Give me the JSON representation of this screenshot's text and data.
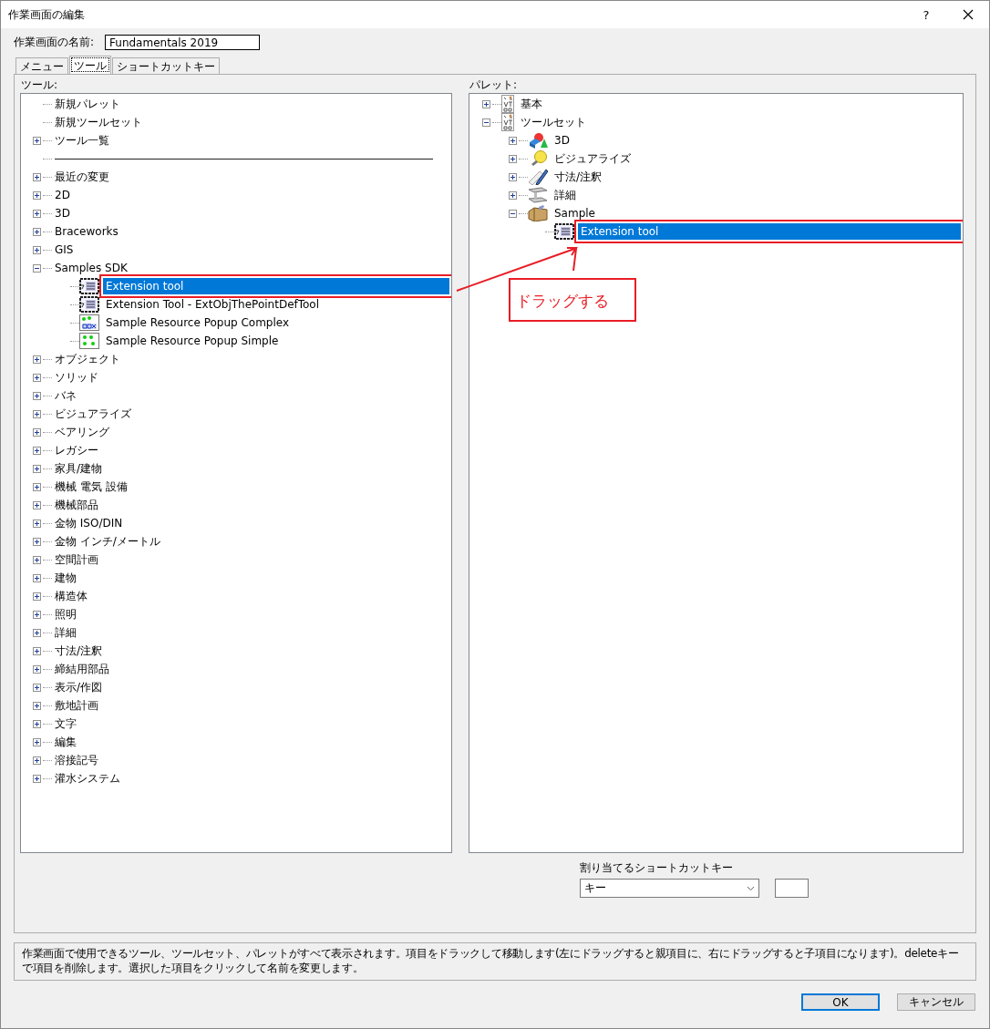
{
  "window": {
    "title": "作業画面の編集",
    "help_button": "?"
  },
  "name_field": {
    "label": "作業画面の名前:",
    "value": "Fundamentals 2019"
  },
  "tabs": [
    {
      "label": "メニュー",
      "selected": false
    },
    {
      "label": "ツール",
      "selected": true
    },
    {
      "label": "ショートカットキー",
      "selected": false
    }
  ],
  "tools_panel": {
    "label": "ツール:",
    "items": [
      {
        "label": "新規パレット",
        "kind": "entry",
        "selected": false
      },
      {
        "label": "新規ツールセット",
        "kind": "entry",
        "selected": false
      },
      {
        "label": "ツール一覧",
        "kind": "folder",
        "expanded": false,
        "selected": false
      },
      {
        "kind": "separator"
      },
      {
        "label": "最近の変更",
        "kind": "folder",
        "expanded": false,
        "selected": false
      },
      {
        "label": "2D",
        "kind": "folder",
        "expanded": false,
        "selected": false
      },
      {
        "label": "3D",
        "kind": "folder",
        "expanded": false,
        "selected": false
      },
      {
        "label": "Braceworks",
        "kind": "folder",
        "expanded": false,
        "selected": false
      },
      {
        "label": "GIS",
        "kind": "folder",
        "expanded": false,
        "selected": false
      },
      {
        "label": "Samples SDK",
        "kind": "folder",
        "expanded": true,
        "selected": false,
        "children": [
          {
            "label": "Extension tool",
            "kind": "tool",
            "selected": true,
            "marked": true
          },
          {
            "label": "Extension Tool - ExtObjThePointDefTool",
            "kind": "tool",
            "selected": false
          },
          {
            "label": "Sample Resource Popup Complex",
            "kind": "popup-complex",
            "selected": false
          },
          {
            "label": "Sample Resource Popup Simple",
            "kind": "popup-simple",
            "selected": false
          }
        ]
      },
      {
        "label": "オブジェクト",
        "kind": "folder",
        "expanded": false,
        "selected": false
      },
      {
        "label": "ソリッド",
        "kind": "folder",
        "expanded": false,
        "selected": false
      },
      {
        "label": "バネ",
        "kind": "folder",
        "expanded": false,
        "selected": false
      },
      {
        "label": "ビジュアライズ",
        "kind": "folder",
        "expanded": false,
        "selected": false
      },
      {
        "label": "ベアリング",
        "kind": "folder",
        "expanded": false,
        "selected": false
      },
      {
        "label": "レガシー",
        "kind": "folder",
        "expanded": false,
        "selected": false
      },
      {
        "label": "家具/建物",
        "kind": "folder",
        "expanded": false,
        "selected": false
      },
      {
        "label": "機械 電気 設備",
        "kind": "folder",
        "expanded": false,
        "selected": false
      },
      {
        "label": "機械部品",
        "kind": "folder",
        "expanded": false,
        "selected": false
      },
      {
        "label": "金物 ISO/DIN",
        "kind": "folder",
        "expanded": false,
        "selected": false
      },
      {
        "label": "金物 インチ/メートル",
        "kind": "folder",
        "expanded": false,
        "selected": false
      },
      {
        "label": "空間計画",
        "kind": "folder",
        "expanded": false,
        "selected": false
      },
      {
        "label": "建物",
        "kind": "folder",
        "expanded": false,
        "selected": false
      },
      {
        "label": "構造体",
        "kind": "folder",
        "expanded": false,
        "selected": false
      },
      {
        "label": "照明",
        "kind": "folder",
        "expanded": false,
        "selected": false
      },
      {
        "label": "詳細",
        "kind": "folder",
        "expanded": false,
        "selected": false
      },
      {
        "label": "寸法/注釈",
        "kind": "folder",
        "expanded": false,
        "selected": false
      },
      {
        "label": "締結用部品",
        "kind": "folder",
        "expanded": false,
        "selected": false
      },
      {
        "label": "表示/作図",
        "kind": "folder",
        "expanded": false,
        "selected": false
      },
      {
        "label": "敷地計画",
        "kind": "folder",
        "expanded": false,
        "selected": false
      },
      {
        "label": "文字",
        "kind": "folder",
        "expanded": false,
        "selected": false
      },
      {
        "label": "編集",
        "kind": "folder",
        "expanded": false,
        "selected": false
      },
      {
        "label": "溶接記号",
        "kind": "folder",
        "expanded": false,
        "selected": false
      },
      {
        "label": "灌水システム",
        "kind": "folder",
        "expanded": false,
        "selected": false
      }
    ]
  },
  "palette_panel": {
    "label": "パレット:",
    "items": [
      {
        "label": "基本",
        "kind": "palette",
        "expanded": false,
        "selected": false
      },
      {
        "label": "ツールセット",
        "kind": "palette",
        "expanded": true,
        "selected": false,
        "children": [
          {
            "label": "3D",
            "kind": "shapes",
            "expanded": false,
            "selected": false
          },
          {
            "label": "ビジュアライズ",
            "kind": "bulb",
            "expanded": false,
            "selected": false
          },
          {
            "label": "寸法/注釈",
            "kind": "pencil",
            "expanded": false,
            "selected": false
          },
          {
            "label": "詳細",
            "kind": "beam",
            "expanded": false,
            "selected": false
          },
          {
            "label": "Sample",
            "kind": "toolbox",
            "expanded": true,
            "selected": false,
            "children": [
              {
                "label": "Extension tool",
                "kind": "tool",
                "selected": true,
                "marked": true
              }
            ]
          }
        ]
      }
    ]
  },
  "shortcut": {
    "label": "割り当てるショートカットキー",
    "value": "キー"
  },
  "description": "作業画面で使用できるツール、ツールセット、パレットがすべて表示されます。項目をドラックして移動します(左にドラッグすると親項目に、右にドラッグすると子項目になります)。deleteキーで項目を削除します。選択した項目をクリックして名前を変更します。",
  "buttons": [
    {
      "label": "OK",
      "default": true
    },
    {
      "label": "キャンセル",
      "default": false
    }
  ],
  "annotation": {
    "callout": "ドラッグする"
  }
}
